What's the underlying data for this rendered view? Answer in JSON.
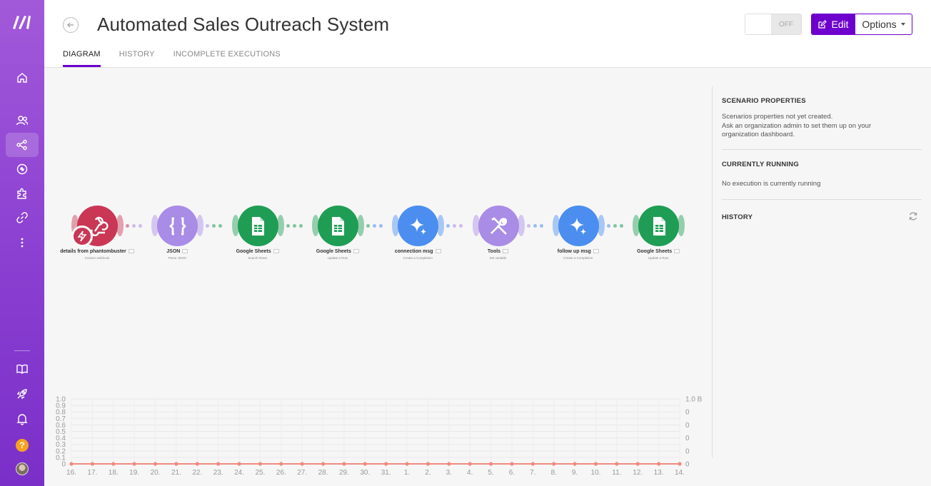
{
  "header": {
    "title": "Automated Sales Outreach System",
    "tabs": [
      {
        "label": "DIAGRAM",
        "active": true
      },
      {
        "label": "HISTORY",
        "active": false
      },
      {
        "label": "INCOMPLETE EXECUTIONS",
        "active": false
      }
    ],
    "toggle_state": "OFF",
    "edit_label": "Edit",
    "options_label": "Options"
  },
  "sidebar": {
    "items": [
      {
        "icon": "home-icon"
      },
      {
        "icon": "team-icon"
      },
      {
        "icon": "scenarios-icon",
        "active": true
      },
      {
        "icon": "templates-icon"
      },
      {
        "icon": "apps-icon"
      },
      {
        "icon": "connections-icon"
      },
      {
        "icon": "more-icon"
      }
    ],
    "bottom": [
      {
        "icon": "docs-icon"
      },
      {
        "icon": "rocket-icon"
      },
      {
        "icon": "bell-icon"
      },
      {
        "icon": "help-icon",
        "label": "?"
      },
      {
        "icon": "avatar"
      }
    ]
  },
  "modules": [
    {
      "name": "details from phantombuster",
      "sub": "Custom webhook",
      "color": "#c93755",
      "icon": "webhook-icon"
    },
    {
      "name": "JSON",
      "sub": "Parse JSON",
      "color": "#a98ce6",
      "icon": "json-icon"
    },
    {
      "name": "Google Sheets",
      "sub": "Search Rows",
      "color": "#1f9d55",
      "icon": "sheets-icon"
    },
    {
      "name": "Google Sheets",
      "sub": "Update a Row",
      "color": "#1f9d55",
      "icon": "sheets-icon"
    },
    {
      "name": "connection msg",
      "sub": "Create a Completion",
      "color": "#4b8ef0",
      "icon": "sparkle-icon"
    },
    {
      "name": "Tools",
      "sub": "Set variable",
      "color": "#a98ce6",
      "icon": "tools-icon"
    },
    {
      "name": "follow up msg",
      "sub": "Create a Completion",
      "color": "#4b8ef0",
      "icon": "sparkle-icon"
    },
    {
      "name": "Google Sheets",
      "sub": "Update a Row",
      "color": "#1f9d55",
      "icon": "sheets-icon"
    }
  ],
  "panel": {
    "scenario_properties_title": "SCENARIO PROPERTIES",
    "scenario_properties_text": "Scenarios properties not yet created.\nAsk an organization admin to set them up on your organization dashboard.",
    "currently_running_title": "CURRENTLY RUNNING",
    "currently_running_text": "No execution is currently running",
    "history_title": "HISTORY"
  },
  "chart_data": {
    "type": "line",
    "x": [
      "16.",
      "17.",
      "18.",
      "19.",
      "20.",
      "21.",
      "22.",
      "23.",
      "24.",
      "25.",
      "26.",
      "27.",
      "28.",
      "29.",
      "30.",
      "31.",
      "1.",
      "2.",
      "3.",
      "4.",
      "5.",
      "6.",
      "7.",
      "8.",
      "9.",
      "10.",
      "11.",
      "12.",
      "13.",
      "14."
    ],
    "series": [
      {
        "values": [
          0,
          0,
          0,
          0,
          0,
          0,
          0,
          0,
          0,
          0,
          0,
          0,
          0,
          0,
          0,
          0,
          0,
          0,
          0,
          0,
          0,
          0,
          0,
          0,
          0,
          0,
          0,
          0,
          0,
          0
        ],
        "color": "#f08a7e"
      }
    ],
    "y_ticks": [
      "1.0",
      "0.9",
      "0.8",
      "0.7",
      "0.6",
      "0.5",
      "0.4",
      "0.3",
      "0.2",
      "0.1",
      "0"
    ],
    "y2_ticks": [
      "1.0 B",
      "0",
      "0",
      "0",
      "0",
      "0"
    ],
    "ylim": [
      0,
      1
    ],
    "grid": true
  }
}
